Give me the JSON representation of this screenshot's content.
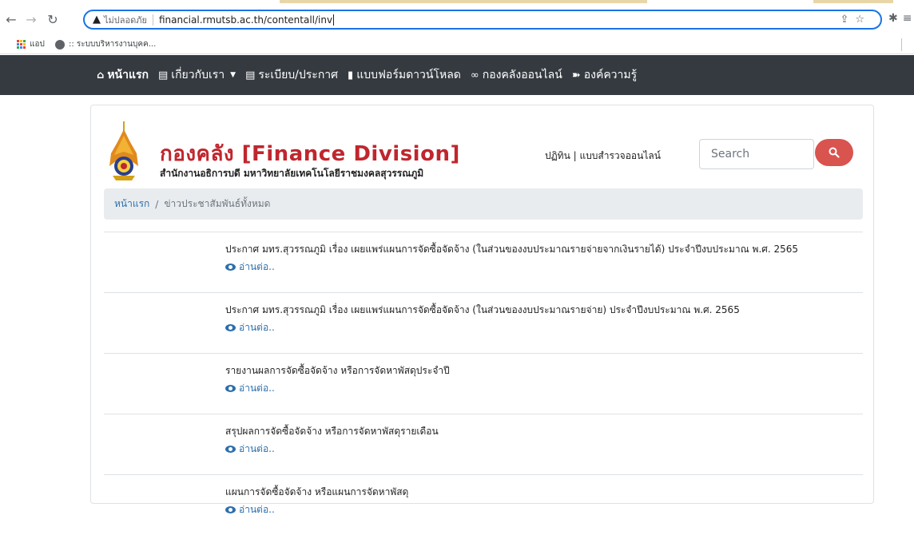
{
  "browser": {
    "security_warning": "ไม่ปลอดภัย",
    "url": "financial.rmutsb.ac.th/contentall/inv",
    "bookmarks": [
      {
        "label": "แอป",
        "icon": "apps-grid-icon"
      },
      {
        "label": ":: ระบบบริหารงานบุคค...",
        "icon": "globe-icon"
      }
    ]
  },
  "nav": {
    "items": [
      {
        "label": "หน้าแรก",
        "icon": "home-icon",
        "active": true
      },
      {
        "label": "เกี่ยวกับเรา",
        "icon": "info-icon",
        "dropdown": true
      },
      {
        "label": "ระเบียบ/ประกาศ",
        "icon": "document-icon"
      },
      {
        "label": "แบบฟอร์มดาวน์โหลด",
        "icon": "file-icon"
      },
      {
        "label": "กองคลังออนไลน์",
        "icon": "link-icon"
      },
      {
        "label": "องค์ความรู้",
        "icon": "knowledge-icon"
      }
    ]
  },
  "header": {
    "title": "กองคลัง [Finance Division]",
    "subtitle": "สำนักงานอธิการบดี มหาวิทยาลัยเทคโนโลยีราชมงคลสุวรรณภูมิ",
    "links": "ปฏิทิน | แบบสำรวจออนไลน์",
    "search_placeholder": "Search"
  },
  "breadcrumb": {
    "home": "หน้าแรก",
    "separator": "/",
    "current": "ข่าวประชาสัมพันธ์ทั้งหมด"
  },
  "news": [
    {
      "title": "ประกาศ มทร.สุวรรณภูมิ เรื่อง เผยแพร่แผนการจัดซื้อจัดจ้าง (ในส่วนของงบประมาณรายจ่ายจากเงินรายได้) ประจำปีงบประมาณ พ.ศ. 2565",
      "link": "อ่านต่อ.."
    },
    {
      "title": "ประกาศ มทร.สุวรรณภูมิ เรื่อง เผยแพร่แผนการจัดซื้อจัดจ้าง (ในส่วนของงบประมาณรายจ่าย) ประจำปีงบประมาณ พ.ศ. 2565",
      "link": "อ่านต่อ.."
    },
    {
      "title": "รายงานผลการจัดซื้อจัดจ้าง หรือการจัดหาพัสดุประจำปี",
      "link": "อ่านต่อ.."
    },
    {
      "title": "สรุปผลการจัดซื้อจัดจ้าง หรือการจัดหาพัสดุรายเดือน",
      "link": "อ่านต่อ.."
    },
    {
      "title": "แผนการจัดซื้อจัดจ้าง หรือแผนการจัดหาพัสดุ",
      "link": "อ่านต่อ.."
    }
  ],
  "colors": {
    "navbar": "#343a40",
    "brand_red": "#c0262d",
    "link_blue": "#2c6fad",
    "search_button": "#d9534f"
  }
}
